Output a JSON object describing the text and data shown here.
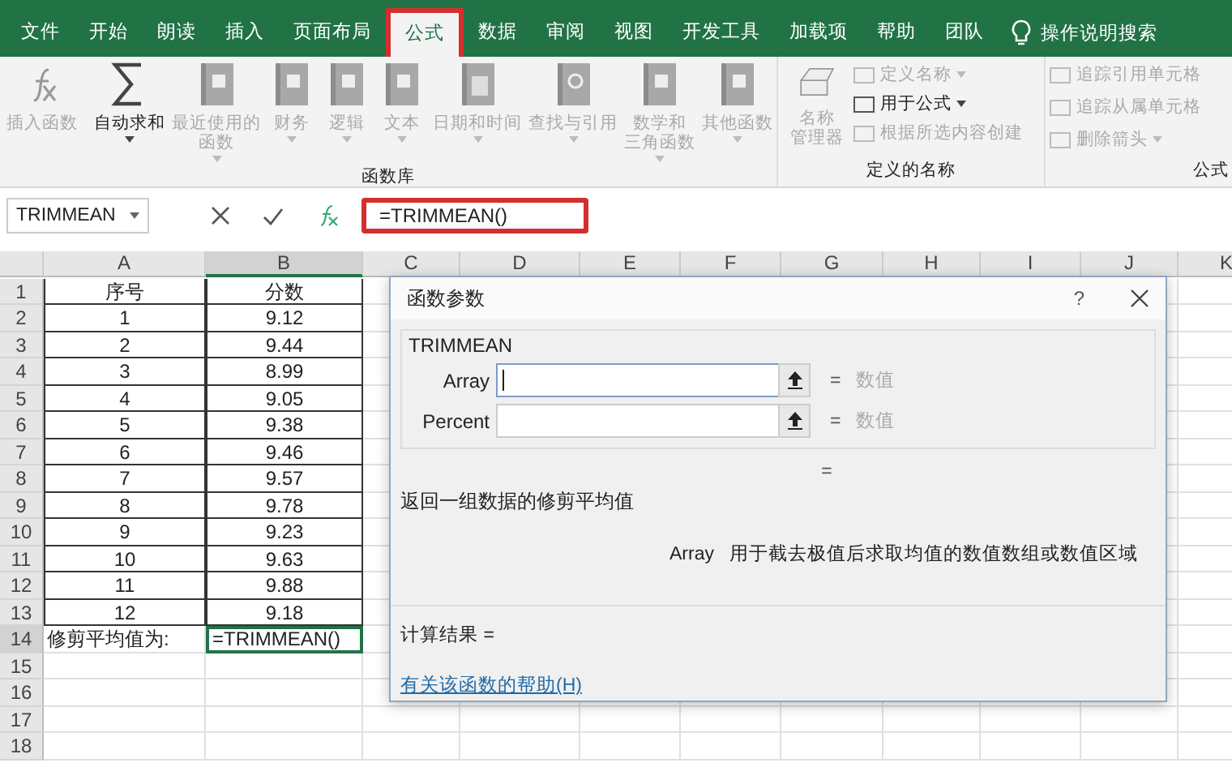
{
  "tabs": [
    {
      "label": "文件",
      "selected": false,
      "highlighted": false
    },
    {
      "label": "开始",
      "selected": false,
      "highlighted": false
    },
    {
      "label": "朗读",
      "selected": false,
      "highlighted": false
    },
    {
      "label": "插入",
      "selected": false,
      "highlighted": false
    },
    {
      "label": "页面布局",
      "selected": false,
      "highlighted": false
    },
    {
      "label": "公式",
      "selected": true,
      "highlighted": true
    },
    {
      "label": "数据",
      "selected": false,
      "highlighted": false
    },
    {
      "label": "审阅",
      "selected": false,
      "highlighted": false
    },
    {
      "label": "视图",
      "selected": false,
      "highlighted": false
    },
    {
      "label": "开发工具",
      "selected": false,
      "highlighted": false
    },
    {
      "label": "加载项",
      "selected": false,
      "highlighted": false
    },
    {
      "label": "帮助",
      "selected": false,
      "highlighted": false
    },
    {
      "label": "团队",
      "selected": false,
      "highlighted": false
    }
  ],
  "tell_me": {
    "placeholder": "操作说明搜索"
  },
  "ribbon": {
    "groups": [
      {
        "label": "函数库",
        "items": [
          {
            "kind": "large",
            "lines": [
              "插入函数"
            ],
            "disabled": true,
            "dropdown": false
          },
          {
            "kind": "large",
            "lines": [
              "自动求和"
            ],
            "disabled": false,
            "dropdown": true
          },
          {
            "kind": "large",
            "lines": [
              "最近使用的",
              "函数"
            ],
            "disabled": true,
            "dropdown": true
          },
          {
            "kind": "large",
            "lines": [
              "财务"
            ],
            "disabled": true,
            "dropdown": true
          },
          {
            "kind": "large",
            "lines": [
              "逻辑"
            ],
            "disabled": true,
            "dropdown": true
          },
          {
            "kind": "large",
            "lines": [
              "文本"
            ],
            "disabled": true,
            "dropdown": true
          },
          {
            "kind": "large",
            "lines": [
              "日期和时间"
            ],
            "disabled": true,
            "dropdown": true
          },
          {
            "kind": "large",
            "lines": [
              "查找与引用"
            ],
            "disabled": true,
            "dropdown": true
          },
          {
            "kind": "large",
            "lines": [
              "数学和",
              "三角函数"
            ],
            "disabled": true,
            "dropdown": true
          },
          {
            "kind": "large",
            "lines": [
              "其他函数"
            ],
            "disabled": true,
            "dropdown": true
          }
        ]
      },
      {
        "label": "定义的名称",
        "items": [
          {
            "kind": "large",
            "lines": [
              "名称",
              "管理器"
            ],
            "disabled": true,
            "dropdown": false
          },
          {
            "kind": "small",
            "lines": [
              "定义名称"
            ],
            "disabled": true,
            "dropdown": true
          },
          {
            "kind": "small",
            "lines": [
              "用于公式"
            ],
            "disabled": false,
            "dropdown": true
          },
          {
            "kind": "small",
            "lines": [
              "根据所选内容创建"
            ],
            "disabled": true,
            "dropdown": false
          }
        ]
      },
      {
        "label": "公式",
        "items": [
          {
            "kind": "small",
            "lines": [
              "追踪引用单元格"
            ],
            "disabled": true,
            "dropdown": false
          },
          {
            "kind": "small",
            "lines": [
              "追踪从属单元格"
            ],
            "disabled": true,
            "dropdown": false
          },
          {
            "kind": "small",
            "lines": [
              "删除箭头"
            ],
            "disabled": true,
            "dropdown": true
          }
        ]
      }
    ]
  },
  "formula_bar": {
    "name_box": "TRIMMEAN",
    "formula": "=TRIMMEAN()",
    "highlighted": true
  },
  "sheet": {
    "columns": [
      {
        "label": "A",
        "selected": false
      },
      {
        "label": "B",
        "selected": true
      },
      {
        "label": "C",
        "selected": false
      },
      {
        "label": "D",
        "selected": false
      },
      {
        "label": "E",
        "selected": false
      },
      {
        "label": "F",
        "selected": false
      },
      {
        "label": "G",
        "selected": false
      },
      {
        "label": "H",
        "selected": false
      },
      {
        "label": "I",
        "selected": false
      },
      {
        "label": "J",
        "selected": false
      },
      {
        "label": "K",
        "selected": false
      }
    ],
    "rows": [
      {
        "number": "1",
        "cells": [
          "序号",
          "分数"
        ],
        "selected": false
      },
      {
        "number": "2",
        "cells": [
          "1",
          "9.12"
        ],
        "selected": false
      },
      {
        "number": "3",
        "cells": [
          "2",
          "9.44"
        ],
        "selected": false
      },
      {
        "number": "4",
        "cells": [
          "3",
          "8.99"
        ],
        "selected": false
      },
      {
        "number": "5",
        "cells": [
          "4",
          "9.05"
        ],
        "selected": false
      },
      {
        "number": "6",
        "cells": [
          "5",
          "9.38"
        ],
        "selected": false
      },
      {
        "number": "7",
        "cells": [
          "6",
          "9.46"
        ],
        "selected": false
      },
      {
        "number": "8",
        "cells": [
          "7",
          "9.57"
        ],
        "selected": false
      },
      {
        "number": "9",
        "cells": [
          "8",
          "9.78"
        ],
        "selected": false
      },
      {
        "number": "10",
        "cells": [
          "9",
          "9.23"
        ],
        "selected": false
      },
      {
        "number": "11",
        "cells": [
          "10",
          "9.63"
        ],
        "selected": false
      },
      {
        "number": "12",
        "cells": [
          "11",
          "9.88"
        ],
        "selected": false
      },
      {
        "number": "13",
        "cells": [
          "12",
          "9.18"
        ],
        "selected": false
      },
      {
        "number": "14",
        "cells": [
          "修剪平均值为:",
          "=TRIMMEAN()"
        ],
        "selected": true
      },
      {
        "number": "15",
        "cells": [],
        "selected": false
      },
      {
        "number": "16",
        "cells": [],
        "selected": false
      },
      {
        "number": "17",
        "cells": [],
        "selected": false
      },
      {
        "number": "18",
        "cells": [],
        "selected": false
      }
    ]
  },
  "dialog": {
    "title": "函数参数",
    "help": "?",
    "function_name": "TRIMMEAN",
    "arguments": [
      {
        "label": "Array",
        "equals": "=",
        "value_hint": "数值",
        "focused": true
      },
      {
        "label": "Percent",
        "equals": "=",
        "value_hint": "数值",
        "focused": false
      }
    ],
    "equals": "=",
    "description": "返回一组数据的修剪平均值",
    "argument_name": "Array",
    "argument_help": "用于截去极值后求取均值的数值数组或数值区域",
    "result_label": "计算结果 =",
    "help_link": "有关该函数的帮助(H)"
  }
}
